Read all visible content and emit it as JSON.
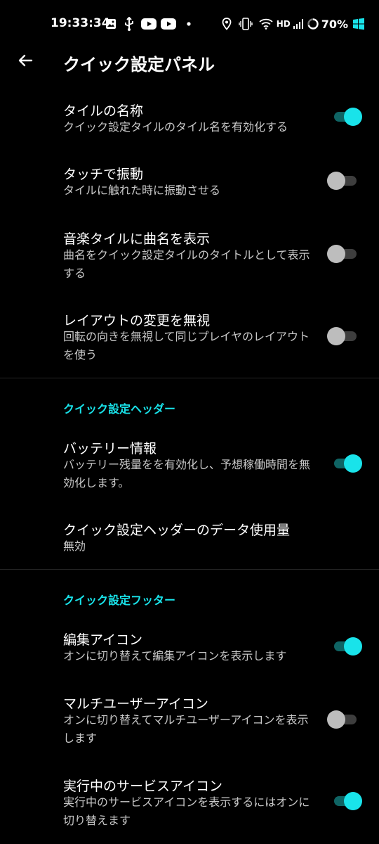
{
  "status_bar": {
    "time": "19:33:34",
    "network": "HD",
    "battery_percent": "70%",
    "left_icons": [
      "image-icon",
      "usb-icon",
      "youtube-icon",
      "youtube-icon",
      "dot-icon"
    ],
    "right_icons": [
      "location-icon",
      "vibrate-icon",
      "wifi-icon",
      "signal-icon",
      "battery-ring-icon",
      "windows-icon"
    ]
  },
  "app_bar": {
    "title": "クイック設定パネル"
  },
  "colors": {
    "accent": "#19e3ea",
    "background": "#000000",
    "toggle_on_track": "#0f6464",
    "toggle_off_thumb": "#bdbdbd"
  },
  "prefs": {
    "tile_names": {
      "title": "タイルの名称",
      "summary": "クイック設定タイルのタイル名を有効化する",
      "enabled": true
    },
    "touch_vibrate": {
      "title": "タッチで振動",
      "summary": "タイルに触れた時に振動させる",
      "enabled": false
    },
    "music_tile_title": {
      "title": "音楽タイルに曲名を表示",
      "summary": "曲名をクイック設定タイルのタイトルとして表示する",
      "enabled": false
    },
    "ignore_layout": {
      "title": "レイアウトの変更を無視",
      "summary": "回転の向きを無視して同じプレイヤのレイアウトを使う",
      "enabled": false
    },
    "battery_info": {
      "title": "バッテリー情報",
      "summary": "バッテリー残量をを有効化し、予想稼働時間を無効化します。",
      "enabled": true
    },
    "header_data_usage": {
      "title": "クイック設定ヘッダーのデータ使用量",
      "summary": "無効"
    },
    "edit_icon": {
      "title": "編集アイコン",
      "summary": "オンに切り替えて編集アイコンを表示します",
      "enabled": true
    },
    "multi_user_icon": {
      "title": "マルチユーザーアイコン",
      "summary": "オンに切り替えてマルチユーザーアイコンを表示します",
      "enabled": false
    },
    "running_services_icon": {
      "title": "実行中のサービスアイコン",
      "summary": "実行中のサービスアイコンを表示するにはオンに切り替えます",
      "enabled": true
    }
  },
  "sections": {
    "header": "クイック設定ヘッダー",
    "footer": "クイック設定フッター"
  }
}
